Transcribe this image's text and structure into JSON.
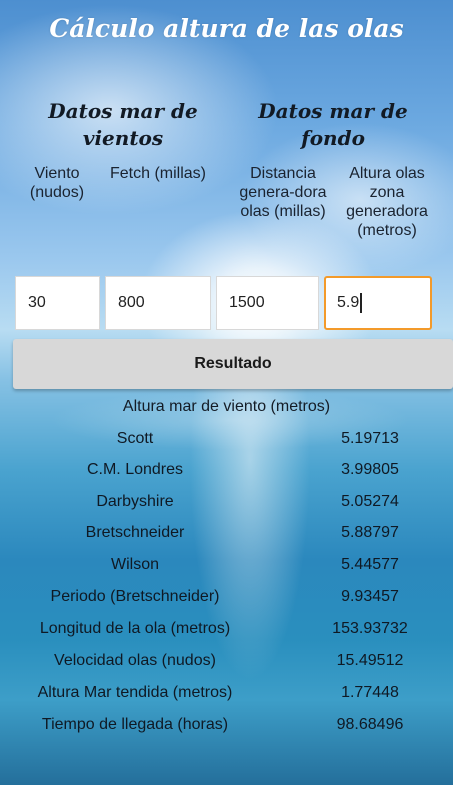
{
  "app": {
    "title": "Cálculo altura de las olas"
  },
  "sections": {
    "wind": "Datos mar de vientos",
    "swell": "Datos mar de fondo"
  },
  "columns": [
    "Viento (nudos)",
    "Fetch (millas)",
    "Distancia genera-dora olas (millas)",
    "Altura olas zona generadora (metros)"
  ],
  "inputs": {
    "viento": "30",
    "fetch": "800",
    "distancia": "1500",
    "altura": "5.9"
  },
  "button": {
    "label": "Resultado"
  },
  "results": {
    "header": "Altura mar de viento (metros)",
    "rows": [
      {
        "label": "Scott",
        "value": "5.19713"
      },
      {
        "label": "C.M. Londres",
        "value": "3.99805"
      },
      {
        "label": "Darbyshire",
        "value": "5.05274"
      },
      {
        "label": "Bretschneider",
        "value": "5.88797"
      },
      {
        "label": "Wilson",
        "value": "5.44577"
      },
      {
        "label": "Periodo (Bretschneider)",
        "value": "9.93457"
      },
      {
        "label": "Longitud de la ola (metros)",
        "value": "153.93732"
      },
      {
        "label": "Velocidad olas (nudos)",
        "value": "15.49512"
      },
      {
        "label": "Altura Mar tendida (metros)",
        "value": "1.77448"
      },
      {
        "label": "Tiempo de llegada (horas)",
        "value": "98.68496"
      }
    ]
  },
  "colors": {
    "accent_focus": "#f39a2a",
    "button_bg": "#d8d8d8",
    "sky_top": "#4d8fd0",
    "sea_bottom": "#246f9b"
  }
}
